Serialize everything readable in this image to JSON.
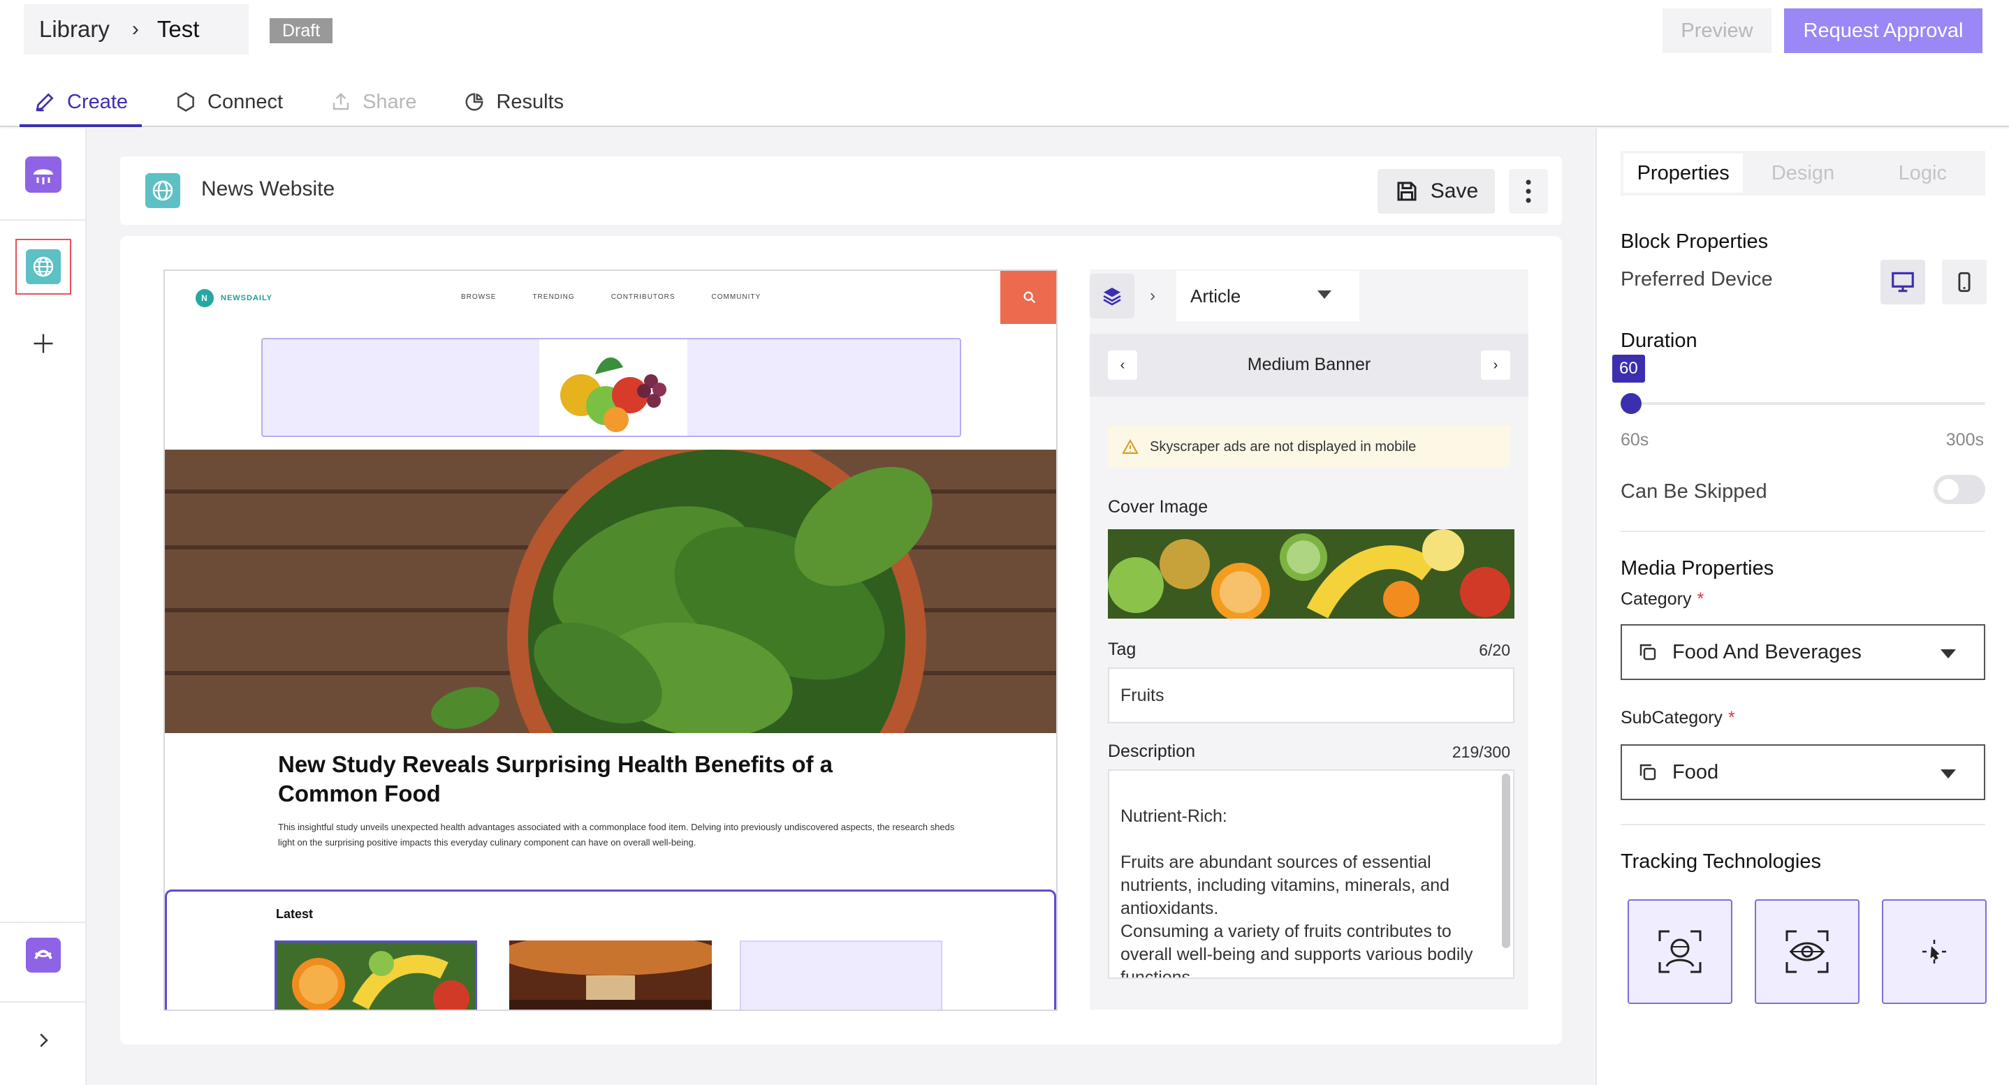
{
  "header": {
    "breadcrumb_root": "Library",
    "breadcrumb_current": "Test",
    "status_badge": "Draft",
    "preview_label": "Preview",
    "approval_label": "Request Approval"
  },
  "tabs": [
    {
      "label": "Create",
      "icon": "pencil-icon",
      "state": "active"
    },
    {
      "label": "Connect",
      "icon": "hexagon-icon",
      "state": "normal"
    },
    {
      "label": "Share",
      "icon": "share-icon",
      "state": "disabled"
    },
    {
      "label": "Results",
      "icon": "pie-chart-icon",
      "state": "normal"
    }
  ],
  "colors": {
    "accent": "#3b2fb0",
    "accent_light": "#9b87f5",
    "search_orange": "#ec6a4e",
    "globe_teal": "#5cc0c5",
    "required_red": "#e0334b"
  },
  "rail": {
    "items": [
      "brand-logo-icon",
      "globe-icon",
      "plus-icon",
      "brand-mark-icon",
      "chevron-right-icon"
    ]
  },
  "canvas": {
    "title": "News Website",
    "save_label": "Save"
  },
  "site": {
    "logo_letter": "N",
    "logo_text": "NEWSDAILY",
    "nav": [
      "BROWSE",
      "TRENDING",
      "CONTRIBUTORS",
      "COMMUNITY"
    ],
    "headline": "New Study Reveals Surprising Health Benefits of a Common Food",
    "summary": "This insightful study unveils unexpected health advantages associated with a commonplace food item. Delving into previously undiscovered aspects, the research sheds light on the surprising positive impacts this everyday culinary component can have on overall well-being.",
    "latest_label": "Latest"
  },
  "editor": {
    "block_type": "Article",
    "banner_name": "Medium Banner",
    "warning": "Skyscraper ads are not displayed in mobile",
    "cover_label": "Cover Image",
    "tag_label": "Tag",
    "tag_count": "6/20",
    "tag_value": "Fruits",
    "description_label": "Description",
    "description_count": "219/300",
    "description_value": "Nutrient-Rich:\n\nFruits are abundant sources of essential nutrients, including vitamins, minerals, and antioxidants.\nConsuming a variety of fruits contributes to overall well-being and supports various bodily functions."
  },
  "properties": {
    "tabs": [
      "Properties",
      "Design",
      "Logic"
    ],
    "active_tab": "Properties",
    "block_title": "Block Properties",
    "preferred_device_label": "Preferred Device",
    "selected_device": "desktop",
    "duration_label": "Duration",
    "duration_value": "60",
    "duration_min": "60s",
    "duration_max": "300s",
    "duration_fraction": 0,
    "skippable_label": "Can Be Skipped",
    "skippable": false,
    "media_title": "Media Properties",
    "category_label": "Category",
    "category_value": "Food And Beverages",
    "subcategory_label": "SubCategory",
    "subcategory_value": "Food",
    "required_mark": "*",
    "tracking_title": "Tracking Technologies",
    "tracking_tiles": [
      "face-scan-icon",
      "eye-scan-icon",
      "gesture-scan-icon"
    ]
  }
}
